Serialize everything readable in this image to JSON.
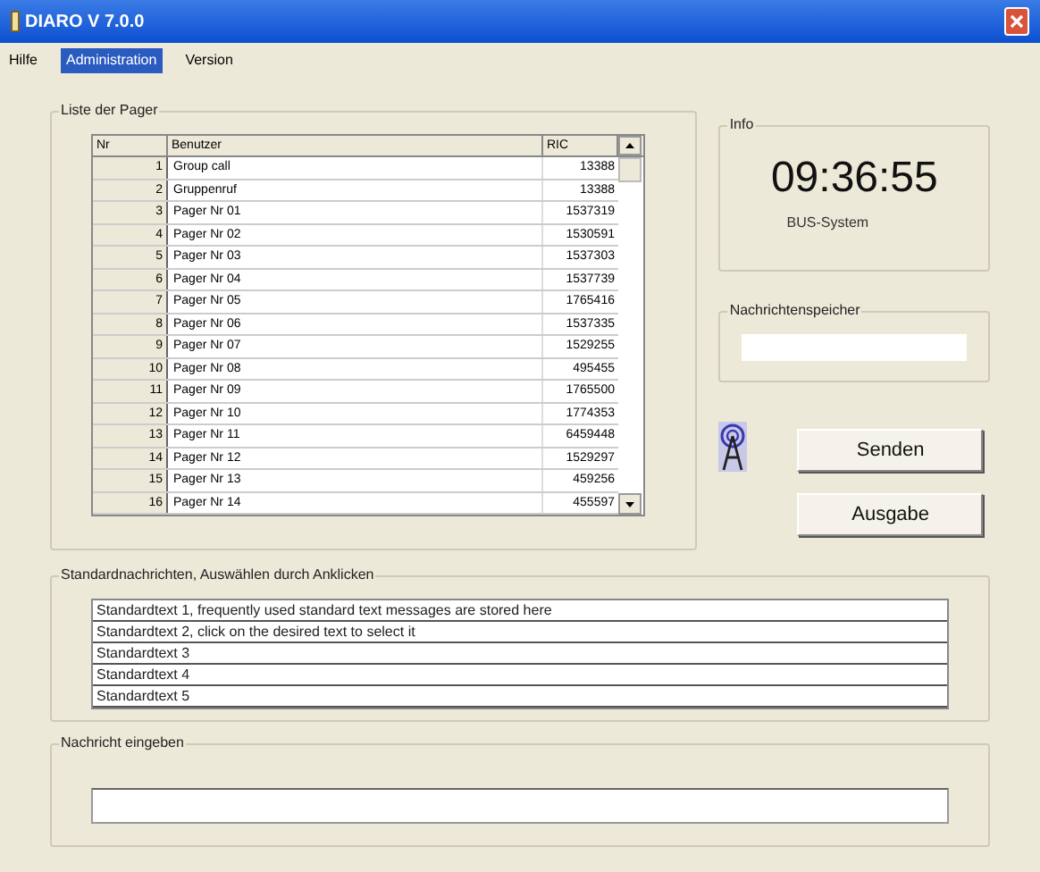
{
  "window": {
    "title": "DIARO V 7.0.0"
  },
  "menu": [
    {
      "label": "Hilfe",
      "selected": false
    },
    {
      "label": "Administration",
      "selected": true
    },
    {
      "label": "Version",
      "selected": false
    }
  ],
  "pager_list": {
    "title": "Liste der Pager",
    "columns": [
      "Nr",
      "Benutzer",
      "RIC"
    ],
    "rows": [
      [
        "1",
        "Group call",
        "13388"
      ],
      [
        "2",
        "Gruppenruf",
        "13388"
      ],
      [
        "3",
        "Pager Nr 01",
        "1537319"
      ],
      [
        "4",
        "Pager Nr 02",
        "1530591"
      ],
      [
        "5",
        "Pager Nr 03",
        "1537303"
      ],
      [
        "6",
        "Pager Nr 04",
        "1537739"
      ],
      [
        "7",
        "Pager Nr 05",
        "1765416"
      ],
      [
        "8",
        "Pager Nr 06",
        "1537335"
      ],
      [
        "9",
        "Pager Nr 07",
        "1529255"
      ],
      [
        "10",
        "Pager Nr 08",
        "495455"
      ],
      [
        "11",
        "Pager Nr 09",
        "1765500"
      ],
      [
        "12",
        "Pager Nr 10",
        "1774353"
      ],
      [
        "13",
        "Pager Nr 11",
        "6459448"
      ],
      [
        "14",
        "Pager Nr 12",
        "1529297"
      ],
      [
        "15",
        "Pager Nr 13",
        "459256"
      ],
      [
        "16",
        "Pager Nr 14",
        "455597"
      ]
    ]
  },
  "info": {
    "title": "Info",
    "time": "09:36:55",
    "system": "BUS-System"
  },
  "message_store": {
    "title": "Nachrichtenspeicher"
  },
  "buttons": [
    "Senden",
    "Ausgabe"
  ],
  "standard_messages": {
    "title": "Standardnachrichten, Auswählen durch Anklicken",
    "items": [
      "Standardtext 1, frequently used standard text messages are stored here",
      "Standardtext 2, click on the desired text to select it",
      "Standardtext 3",
      "Standardtext 4",
      "Standardtext 5"
    ]
  },
  "message_input": {
    "title": "Nachricht eingeben"
  }
}
